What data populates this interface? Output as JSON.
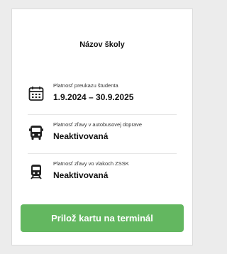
{
  "school": {
    "name": "Názov školy"
  },
  "validity": {
    "label": "Platnosť preukazu študenta",
    "value": "1.9.2024 – 30.9.2025",
    "icon": "calendar-icon"
  },
  "bus_discount": {
    "label": "Platnosť zľavy v autobusovej doprave",
    "value": "Neaktivovaná",
    "icon": "bus-icon"
  },
  "train_discount": {
    "label": "Platnosť zľavy vo vlakoch ZSSK",
    "value": "Neaktivovaná",
    "icon": "train-icon"
  },
  "action": {
    "label": "Prilož kartu na terminál"
  },
  "colors": {
    "accent": "#63b760",
    "background": "#ececec",
    "card": "#ffffff"
  }
}
